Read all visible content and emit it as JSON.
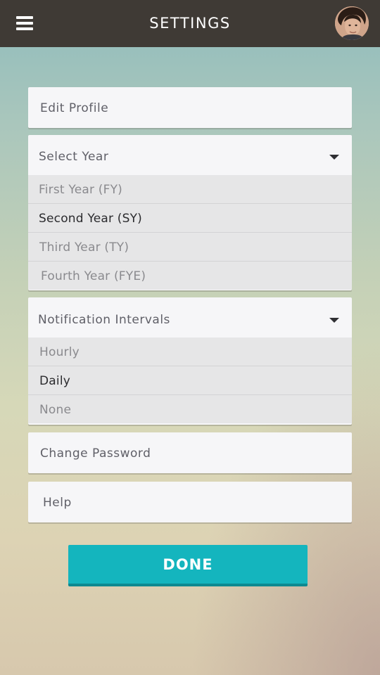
{
  "header": {
    "title": "SETTINGS",
    "menu_icon": "hamburger-menu-icon",
    "avatar": "user-avatar-photo",
    "background_color": "#3f3a35"
  },
  "settings": {
    "edit_profile": "Edit Profile",
    "select_year": {
      "label": "Select Year",
      "options": [
        "First Year (FY)",
        "Second Year (SY)",
        "Third Year (TY)",
        "Fourth Year (FYE)"
      ],
      "selected": "Second Year (SY)"
    },
    "notification_intervals": {
      "label": "Notification Intervals",
      "options": [
        "Hourly",
        "Daily",
        "None"
      ],
      "selected": "Daily"
    },
    "change_password": "Change Password",
    "help": "Help"
  },
  "done_button": {
    "label": "DONE",
    "color": "#14b5be"
  }
}
